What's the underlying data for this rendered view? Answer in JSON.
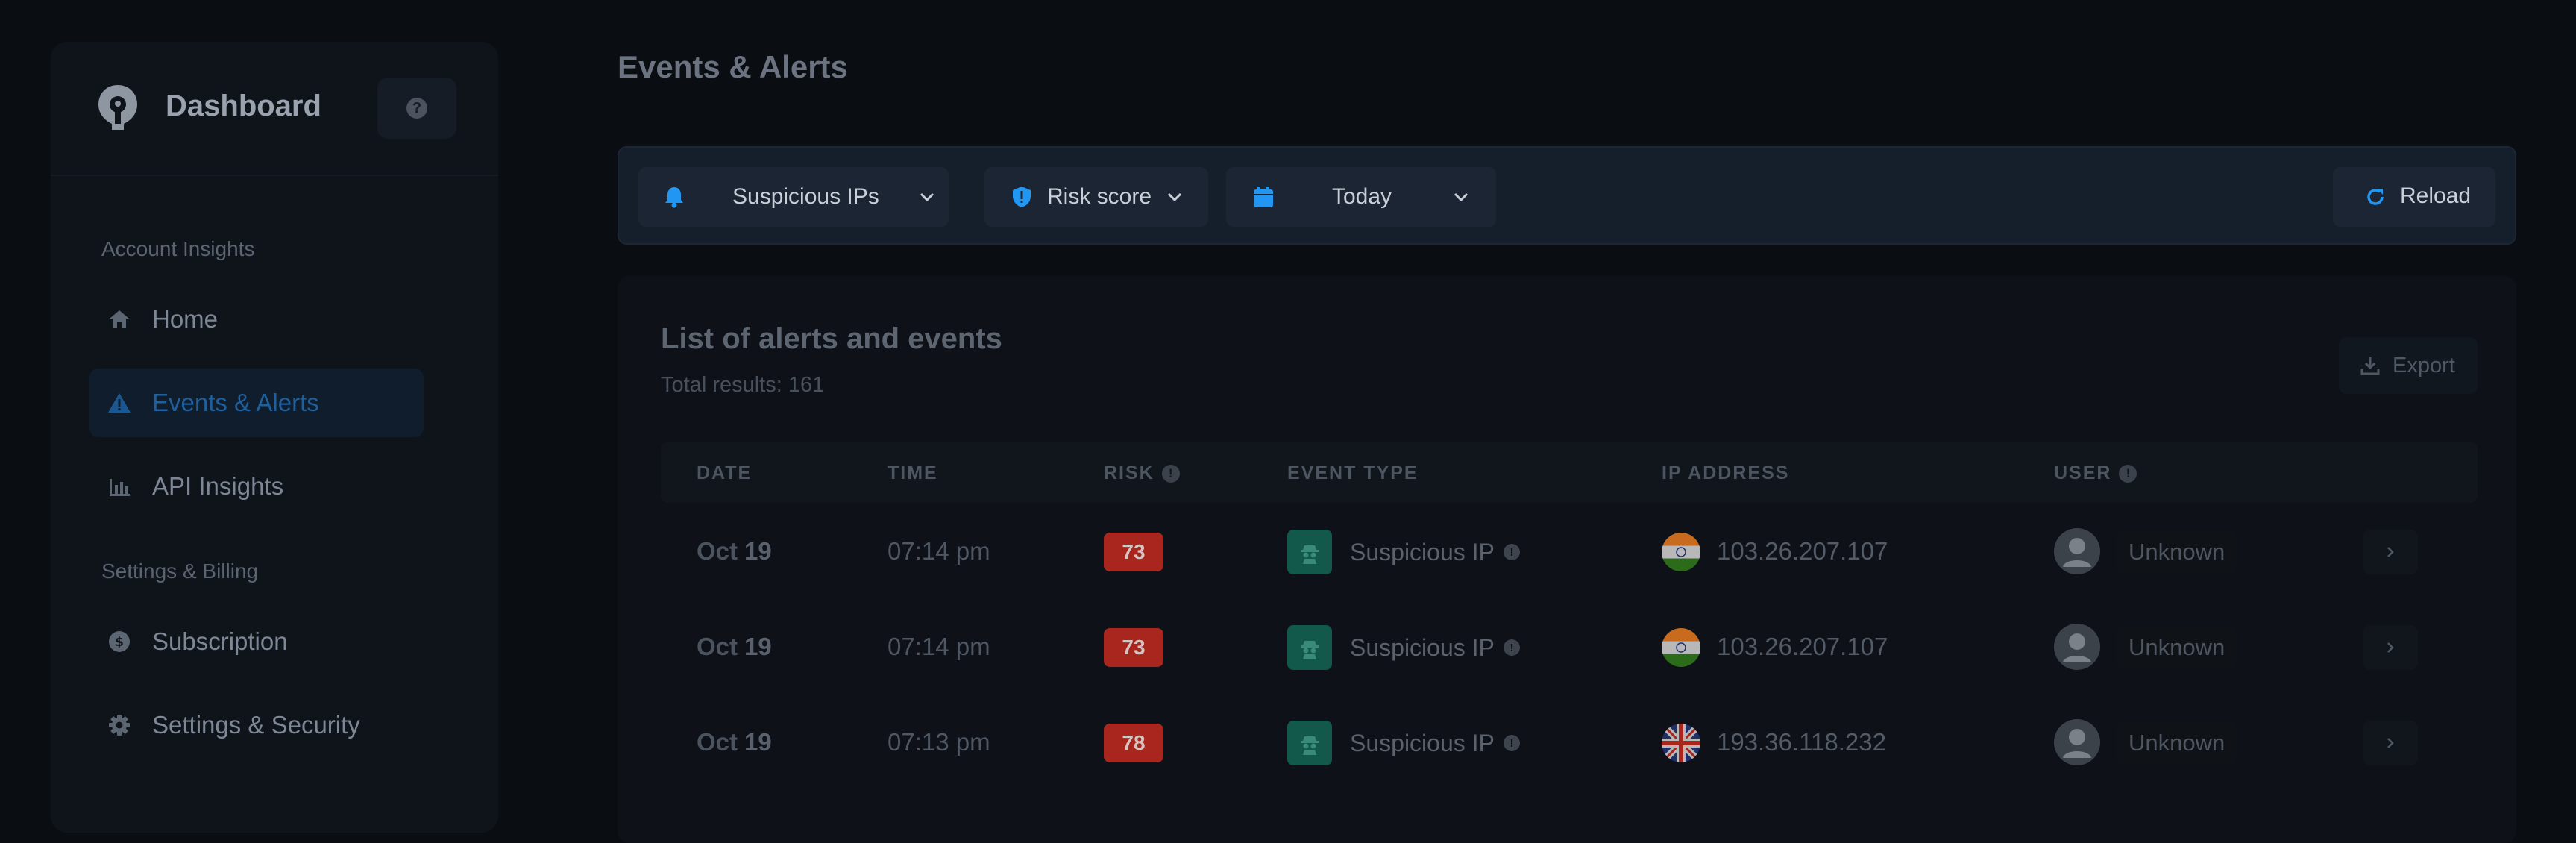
{
  "sidebar": {
    "brand": "Dashboard",
    "help_icon": "question-circle-icon",
    "sections": [
      {
        "label": "Account Insights"
      },
      {
        "label": "Settings & Billing"
      }
    ],
    "items": [
      {
        "label": "Home",
        "icon": "home-icon",
        "active": false
      },
      {
        "label": "Events & Alerts",
        "icon": "warning-icon",
        "active": true
      },
      {
        "label": "API Insights",
        "icon": "bar-chart-icon",
        "active": false
      },
      {
        "label": "Subscription",
        "icon": "dollar-icon",
        "active": false
      },
      {
        "label": "Settings & Security",
        "icon": "gear-icon",
        "active": false
      }
    ]
  },
  "main": {
    "title": "Events & Alerts",
    "filters": [
      {
        "label": "Suspicious IPs",
        "icon": "bell-icon"
      },
      {
        "label": "Risk score",
        "icon": "shield-icon"
      },
      {
        "label": "Today",
        "icon": "calendar-icon"
      }
    ],
    "reload_label": "Reload",
    "list": {
      "title": "List of alerts and events",
      "subtitle": "Total results: 161",
      "export_label": "Export",
      "columns": [
        "DATE",
        "TIME",
        "RISK",
        "EVENT TYPE",
        "IP ADDRESS",
        "USER"
      ],
      "rows": [
        {
          "month": "Oct",
          "day": "19",
          "time": "07:14 pm",
          "risk": "73",
          "event": "Suspicious IP",
          "flag": "india",
          "ip": "103.26.207.107",
          "user": "Unknown"
        },
        {
          "month": "Oct",
          "day": "19",
          "time": "07:14 pm",
          "risk": "73",
          "event": "Suspicious IP",
          "flag": "india",
          "ip": "103.26.207.107",
          "user": "Unknown"
        },
        {
          "month": "Oct",
          "day": "19",
          "time": "07:13 pm",
          "risk": "78",
          "event": "Suspicious IP",
          "flag": "uk",
          "ip": "193.36.118.232",
          "user": "Unknown"
        }
      ]
    }
  },
  "colors": {
    "accent": "#1e88e5",
    "risk_badge": "#a8261d",
    "event_icon_bg": "#12594b",
    "background": "#0a0d12"
  }
}
